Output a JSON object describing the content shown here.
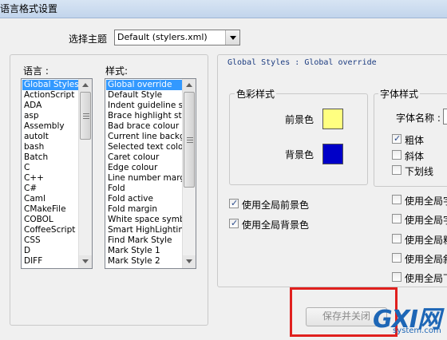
{
  "window": {
    "title": "语言格式设置"
  },
  "theme": {
    "label": "选择主题",
    "value": "Default (stylers.xml)"
  },
  "languages": {
    "label": "语言 :",
    "items": [
      "Global Styles",
      "ActionScript",
      "ADA",
      "asp",
      "Assembly",
      "autoIt",
      "bash",
      "Batch",
      "C",
      "C++",
      "C#",
      "Caml",
      "CMakeFile",
      "COBOL",
      "CoffeeScript",
      "CSS",
      "D",
      "DIFF"
    ],
    "selected_index": 0
  },
  "styles": {
    "label": "样式:",
    "items": [
      "Global override",
      "Default Style",
      "Indent guideline style",
      "Brace highlight style",
      "Bad brace colour",
      "Current line background colour",
      "Selected text colour",
      "Caret colour",
      "Edge colour",
      "Line number margin",
      "Fold",
      "Fold active",
      "Fold margin",
      "White space symbol",
      "Smart HighLighting",
      "Find Mark Style",
      "Mark Style 1",
      "Mark Style 2"
    ],
    "selected_index": 0
  },
  "header_text": "Global Styles : Global override",
  "colour_style": {
    "label": "色彩样式",
    "fg_label": "前景色",
    "bg_label": "背景色",
    "fg_color": "#ffff80",
    "bg_color": "#0000c8"
  },
  "global_color_options": [
    {
      "label": "使用全局前景色",
      "checked": true
    },
    {
      "label": "使用全局背景色",
      "checked": true
    }
  ],
  "font_style": {
    "label": "字体样式",
    "font_name_label": "字体名称 :",
    "options": [
      {
        "label": "粗体",
        "checked": true
      },
      {
        "label": "斜体",
        "checked": false
      },
      {
        "label": "下划线",
        "checked": false
      }
    ]
  },
  "global_font_options": [
    {
      "label": "使用全局字",
      "checked": false
    },
    {
      "label": "使用全局字",
      "checked": false
    },
    {
      "label": "使用全局粗",
      "checked": false
    },
    {
      "label": "使用全局斜",
      "checked": false
    },
    {
      "label": "使用全局下",
      "checked": false
    }
  ],
  "save_button": {
    "label": "保存并关闭"
  },
  "watermark": {
    "main": "GXI网",
    "sub": "system.com"
  }
}
